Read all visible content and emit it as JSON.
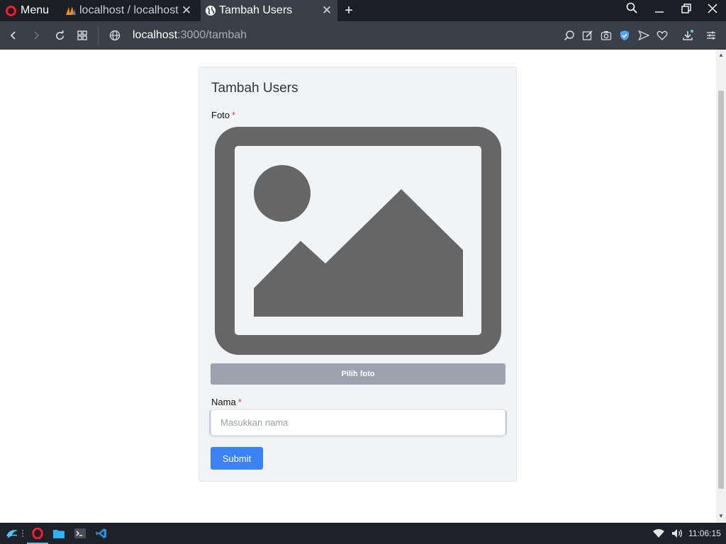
{
  "browser": {
    "menu_label": "Menu",
    "tabs": [
      {
        "title": "localhost / localhost",
        "icon": "phpmyadmin-icon",
        "active": false
      },
      {
        "title": "Tambah Users",
        "icon": "globe-icon",
        "active": true
      }
    ],
    "address": {
      "host": "localhost",
      "path": ":3000/tambah"
    }
  },
  "page": {
    "title": "Tambah Users",
    "photo_field": {
      "label": "Foto",
      "required_mark": "*",
      "pick_button": "Pilih foto"
    },
    "name_field": {
      "label": "Nama",
      "required_mark": "*",
      "placeholder": "Masukkan nama",
      "value": ""
    },
    "submit_label": "Submit"
  },
  "taskbar": {
    "clock": "11:06:15"
  },
  "colors": {
    "accent": "#3b82f6",
    "opera_red": "#ff1b2d",
    "required": "#e53e3e",
    "placeholder_image": "#666666"
  }
}
